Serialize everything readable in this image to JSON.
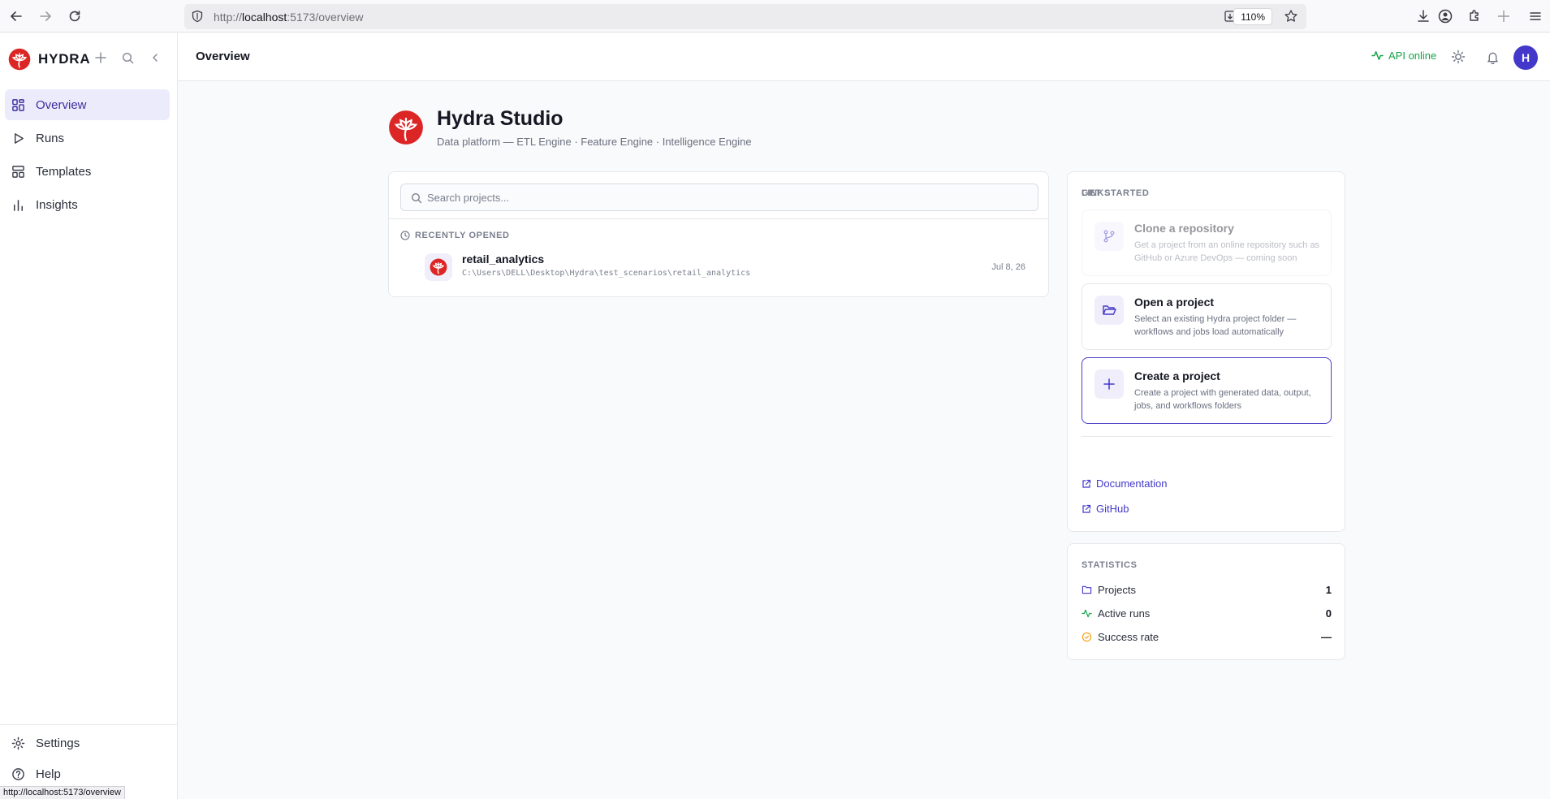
{
  "browser": {
    "url_prefix": "http://",
    "url_host": "localhost",
    "url_rest": ":5173/overview",
    "zoom": "110%",
    "status_url": "http://localhost:5173/overview"
  },
  "sidebar": {
    "brand": "HYDRA",
    "items": [
      {
        "label": "Overview",
        "icon": "grid-icon",
        "active": true
      },
      {
        "label": "Runs",
        "icon": "play-icon"
      },
      {
        "label": "Templates",
        "icon": "templates-icon"
      },
      {
        "label": "Insights",
        "icon": "bar-chart-icon"
      }
    ],
    "bottom": [
      {
        "label": "Settings",
        "icon": "gear-icon"
      },
      {
        "label": "Help",
        "icon": "help-icon"
      }
    ]
  },
  "header": {
    "title": "Overview",
    "api_status": "API online",
    "avatar_initial": "H"
  },
  "hero": {
    "title": "Hydra Studio",
    "subtitle": "Data platform — ETL Engine · Feature Engine · Intelligence Engine"
  },
  "projects": {
    "search_placeholder": "Search projects...",
    "recent_label": "RECENTLY OPENED",
    "recent": [
      {
        "name": "retail_analytics",
        "path": "C:\\Users\\DELL\\Desktop\\Hydra\\test_scenarios\\retail_analytics",
        "date": "Jul 8, 26"
      }
    ]
  },
  "get_started": {
    "label": "GET STARTED",
    "actions": [
      {
        "title": "Clone a repository",
        "desc": "Get a project from an online repository such as GitHub or Azure DevOps — coming soon",
        "icon": "git-branch-icon",
        "disabled": true
      },
      {
        "title": "Open a project",
        "desc": "Select an existing Hydra project folder — workflows and jobs load automatically",
        "icon": "folder-open-icon"
      },
      {
        "title": "Create a project",
        "desc": "Create a project with generated data, output, jobs, and workflows folders",
        "icon": "plus-icon",
        "highlight": true
      }
    ],
    "links_label": "LINKS",
    "links": [
      {
        "label": "Documentation"
      },
      {
        "label": "GitHub"
      }
    ]
  },
  "statistics": {
    "label": "STATISTICS",
    "rows": [
      {
        "label": "Projects",
        "value": "1",
        "icon": "folder-icon"
      },
      {
        "label": "Active runs",
        "value": "0",
        "icon": "activity-icon"
      },
      {
        "label": "Success rate",
        "value": "—",
        "icon": "check-circle-icon"
      }
    ]
  },
  "colors": {
    "accent": "#4338ca",
    "brand_red": "#dc2626",
    "online_green": "#16a34a",
    "success_orange": "#f59e0b"
  }
}
